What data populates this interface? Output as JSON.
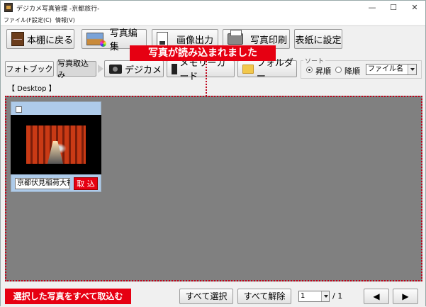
{
  "window": {
    "title": "デジカメ写真管理 -京都旅行-",
    "minimize": "—",
    "maximize": "☐",
    "close": "✕"
  },
  "menu": [
    "ファイル(F)",
    "設定(C)",
    "情報(V)"
  ],
  "toolbar": {
    "back_to_shelf": "本棚に戻る",
    "photo_edit": "写真編集",
    "image_output": "画像出力",
    "photo_print": "写真印刷",
    "set_cover": "表紙に設定"
  },
  "callout": "写真が読み込まれました",
  "tabs": {
    "photobook": "フォトブック",
    "import": "写真取込み"
  },
  "sources": {
    "camera": "デジカメ",
    "memory_card": "メモリーカード",
    "folder": "フォルダー"
  },
  "sort": {
    "legend": "ソート",
    "ascending": "昇順",
    "descending": "降順",
    "ascending_selected": true,
    "field": "ファイル名"
  },
  "path": "【 Desktop 】",
  "photos": [
    {
      "name": "京都伏見稲荷大社",
      "checked": false,
      "import_label": "取 込"
    }
  ],
  "bottom": {
    "import_all": "選択した写真をすべて取込む",
    "select_all": "すべて選択",
    "deselect_all": "すべて解除",
    "page": "1",
    "total": "/ 1",
    "prev": "◀",
    "next": "▶"
  },
  "colors": {
    "accent_red": "#e60012",
    "content_bg": "#808080",
    "card_bg": "#aecbea"
  }
}
